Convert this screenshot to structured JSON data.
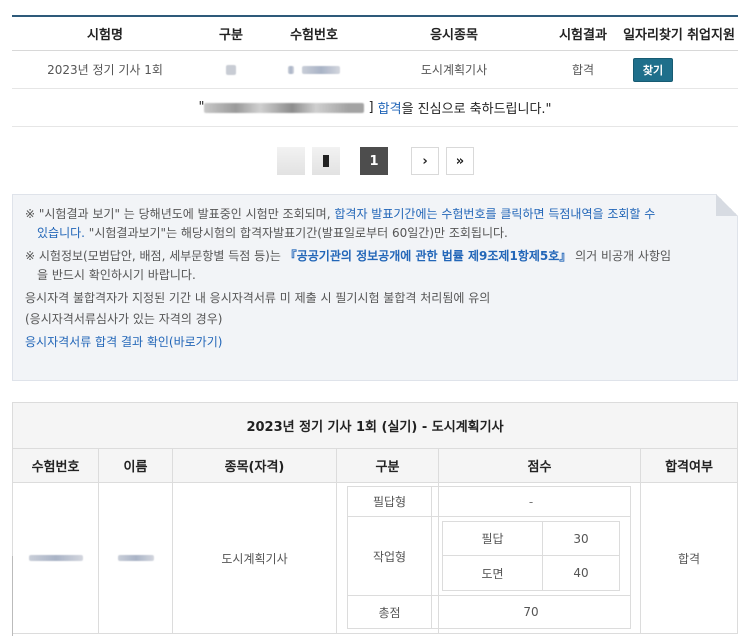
{
  "top_table": {
    "headers": {
      "name": "시험명",
      "type": "구분",
      "number": "수험번호",
      "subject": "응시종목",
      "result": "시험결과",
      "job": "일자리찾기",
      "employment": "취업지원"
    },
    "row": {
      "name": "2023년 정기 기사 1회",
      "subject": "도시계획기사",
      "result": "합격",
      "find_button": "찾기"
    },
    "congrats": {
      "prefix": "\"",
      "close": "]",
      "pass_word": "합격",
      "suffix": "을 진심으로 축하드립니다.\""
    }
  },
  "pagination": {
    "current": "1",
    "next": "›",
    "last": "»"
  },
  "notice": {
    "line1_a": "※ \"시험결과 보기\" 는 당해년도에 발표중인 시험만 조회되며, ",
    "line1_b": "합격자 발표기간에는 수험번호를 클릭하면 득점내역을 조회할 수",
    "line1_c": "있습니다.",
    "line1_d": " \"시험결과보기\"는 해당시험의 합격자발표기간(발표일로부터 60일간)만 조회됩니다.",
    "line2_a": "※ 시험정보(모범답안, 배점, 세부문항별 득점 등)는 ",
    "line2_b": "『공공기관의 정보공개에 관한 법률 제9조제1항제5호』",
    "line2_c": " 의거 비공개 사항임",
    "line2_d": "을 반드시 확인하시기 바랍니다.",
    "line3": "응시자격 불합격자가 지정된 기간 내 응시자격서류 미 제출 시 필기시험 불합격 처리됨에 유의",
    "line4": "(응시자격서류심사가 있는 자격의 경우)",
    "link": "응시자격서류 합격 결과 확인(바로가기)"
  },
  "result_table": {
    "caption": "2023년 정기 기사 1회 (실기) - 도시계획기사",
    "headers": {
      "number": "수험번호",
      "name": "이름",
      "subject": "종목(자격)",
      "type": "구분",
      "score": "점수",
      "pass": "합격여부"
    },
    "subject": "도시계획기사",
    "pass": "합격",
    "scores": {
      "written_label": "필답형",
      "written_value": "-",
      "practical_label": "작업형",
      "sub1_label": "필답",
      "sub1_value": "30",
      "sub2_label": "도면",
      "sub2_value": "40",
      "total_label": "총점",
      "total_value": "70"
    }
  },
  "colors": {
    "header_rule": "#2e5a7a",
    "button": "#1f6f8b",
    "link": "#2266b8",
    "active_page": "#4d4d4d"
  }
}
